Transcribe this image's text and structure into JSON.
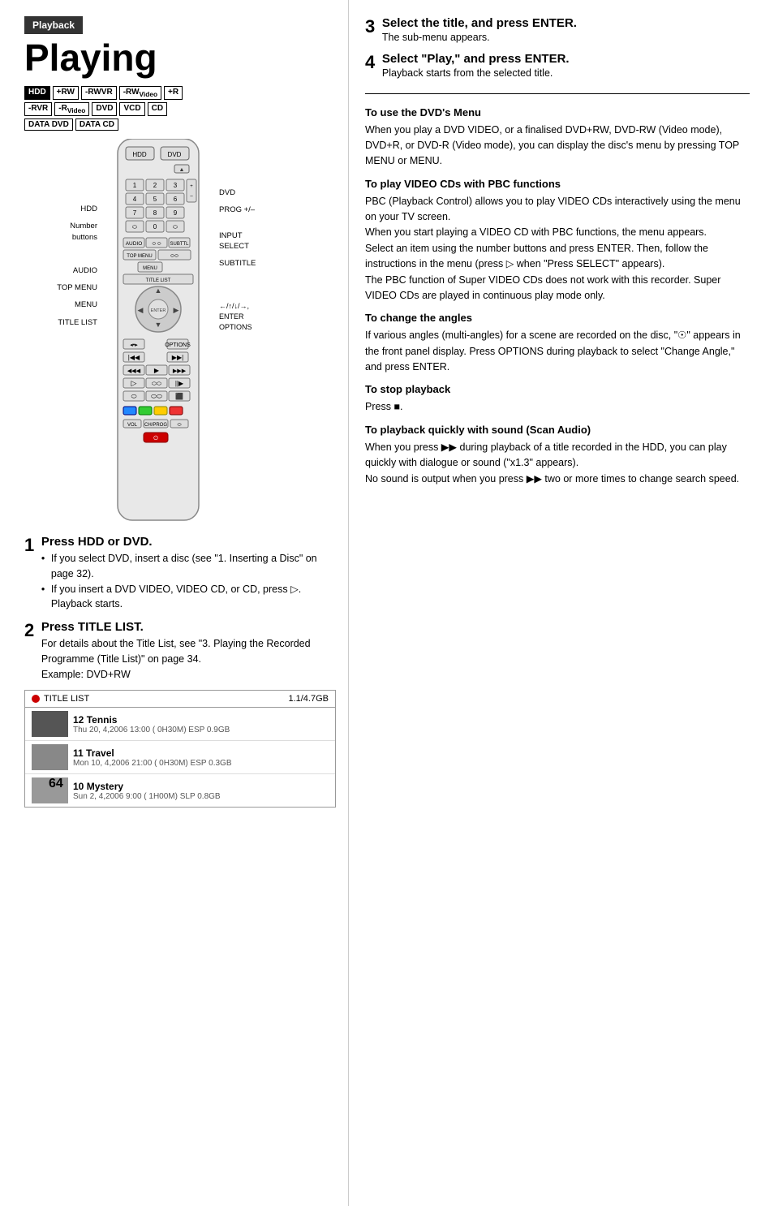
{
  "page": {
    "number": "64",
    "section_badge": "Playback",
    "title": "Playing"
  },
  "format_badges": [
    {
      "label": "HDD",
      "filled": true
    },
    {
      "label": "+RW",
      "filled": false
    },
    {
      "label": "-RWVR",
      "filled": false
    },
    {
      "label": "-RWVideo",
      "filled": false
    },
    {
      "label": "+R",
      "filled": false
    },
    {
      "label": "-RVR",
      "filled": false
    },
    {
      "label": "-RVideo",
      "filled": false
    },
    {
      "label": "DVD",
      "filled": false
    },
    {
      "label": "VCD",
      "filled": false
    },
    {
      "label": "CD",
      "filled": false
    },
    {
      "label": "DATA DVD",
      "filled": false
    },
    {
      "label": "DATA CD",
      "filled": false
    }
  ],
  "remote_labels_left": [
    "HDD",
    "Number buttons",
    "AUDIO",
    "TOP MENU",
    "MENU",
    "TITLE LIST"
  ],
  "remote_labels_right": [
    "DVD",
    "PROG +/–",
    "INPUT SELECT",
    "SUBTITLE"
  ],
  "remote_arrows": "←/↑/↓/→, ENTER OPTIONS",
  "steps_left": [
    {
      "number": "1",
      "title": "Press HDD or DVD.",
      "bullets": [
        "If you select DVD, insert a disc (see \"1. Inserting a Disc\" on page 32).",
        "If you insert a DVD VIDEO, VIDEO CD, or CD, press ▷. Playback starts."
      ]
    },
    {
      "number": "2",
      "title": "Press TITLE LIST.",
      "body": "For details about the Title List, see \"3. Playing the Recorded Programme (Title List)\" on page 34.\nExample: DVD+RW"
    }
  ],
  "title_list": {
    "header_left": "TITLE LIST",
    "header_right": "1.1/4.7GB",
    "items": [
      {
        "number": "12",
        "name": "Tennis",
        "details": "Thu 20, 4,2006  13:00 ( 0H30M) ESP 0.9GB"
      },
      {
        "number": "11",
        "name": "Travel",
        "details": "Mon 10, 4,2006  21:00 ( 0H30M) ESP 0.3GB"
      },
      {
        "number": "10",
        "name": "Mystery",
        "details": "Sun 2, 4,2006   9:00 ( 1H00M) SLP 0.8GB"
      }
    ]
  },
  "steps_right": [
    {
      "number": "3",
      "title": "Select the title, and press ENTER.",
      "body": "The sub-menu appears."
    },
    {
      "number": "4",
      "title": "Select \"Play,\" and press ENTER.",
      "body": "Playback starts from the selected title."
    }
  ],
  "sections": [
    {
      "id": "dvd-menu",
      "heading": "To use the DVD's Menu",
      "text": "When you play a DVD VIDEO, or a finalised DVD+RW, DVD-RW (Video mode), DVD+R, or DVD-R (Video mode), you can display the disc's menu by pressing TOP MENU or MENU."
    },
    {
      "id": "vcd-pbc",
      "heading": "To play VIDEO CDs with PBC functions",
      "text": "PBC (Playback Control) allows you to play VIDEO CDs interactively using the menu on your TV screen.\nWhen you start playing a VIDEO CD with PBC functions, the menu appears.\nSelect an item using the number buttons and press ENTER. Then, follow the instructions in the menu (press ▷ when \"Press SELECT\" appears).\nThe PBC function of Super VIDEO CDs does not work with this recorder. Super VIDEO CDs are played in continuous play mode only."
    },
    {
      "id": "change-angles",
      "heading": "To change the angles",
      "text": "If various angles (multi-angles) for a scene are recorded on the disc, \"⌀\" appears in the front panel display. Press OPTIONS during playback to select \"Change Angle,\" and press ENTER."
    },
    {
      "id": "stop-playback",
      "heading": "To stop playback",
      "text": "Press ■."
    },
    {
      "id": "scan-audio",
      "heading": "To playback quickly with sound (Scan Audio)",
      "text": "When you press ▶▶ during playback of a title recorded in the HDD, you can play quickly with dialogue or sound (\"x1.3\" appears).\nNo sound is output when you press ▶▶ two or more times to change search speed."
    }
  ]
}
